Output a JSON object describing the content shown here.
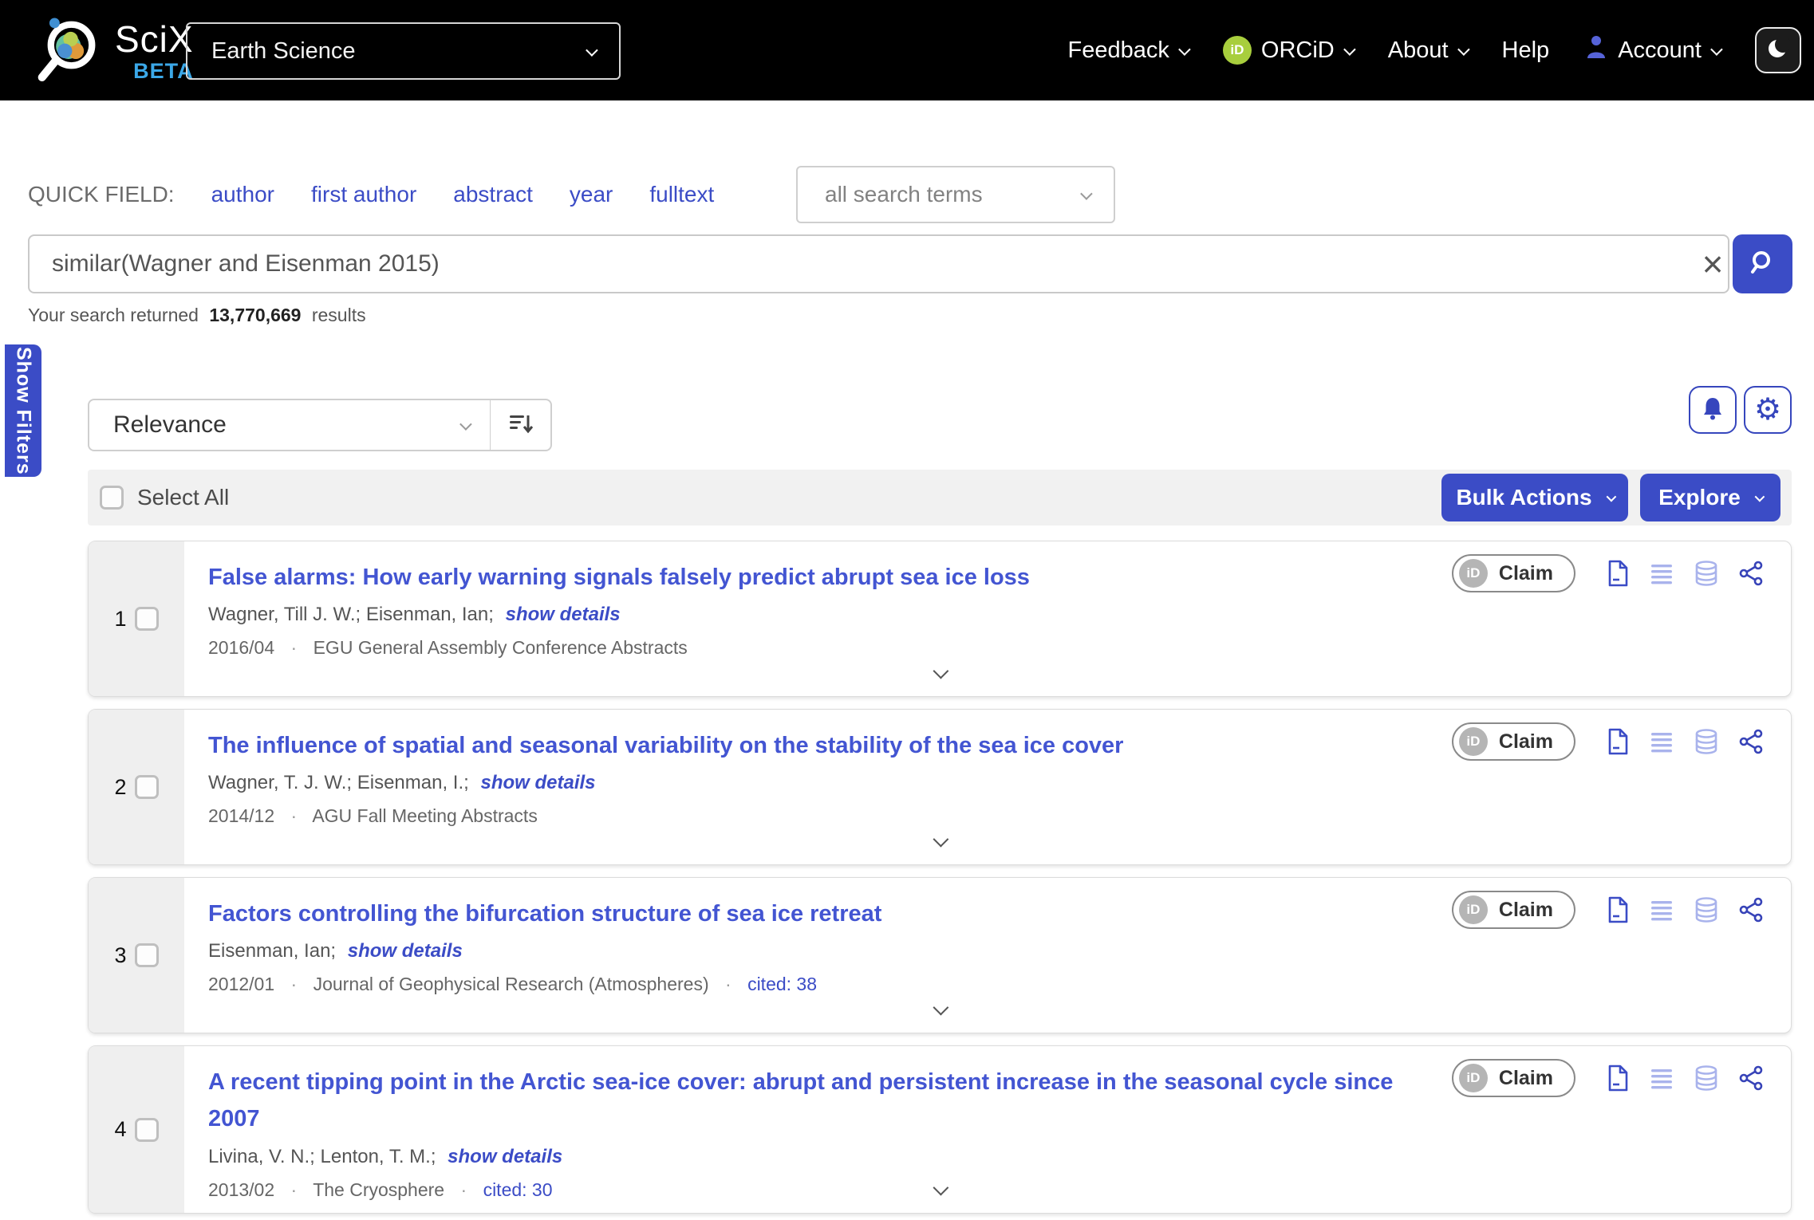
{
  "colors": {
    "accent": "#3b4cc6",
    "link": "#4355d2",
    "orcid_green": "#a8ce3d",
    "beta_blue": "#3ba8e8",
    "navbar_bg": "#000000"
  },
  "navbar": {
    "brand": "SciX",
    "brand_beta": "BETA",
    "collection": "Earth Science",
    "feedback": "Feedback",
    "orcid_icon_text": "iD",
    "orcid": "ORCiD",
    "about": "About",
    "help": "Help",
    "account": "Account"
  },
  "quick_fields": {
    "label": "QUICK FIELD:",
    "author": "author",
    "first_author": "first author",
    "abstract": "abstract",
    "year": "year",
    "fulltext": "fulltext",
    "terms": "all search terms"
  },
  "search": {
    "query": "similar(Wagner and Eisenman 2015)",
    "clear": "×"
  },
  "results_info": {
    "prefix": "Your search returned",
    "count": "13,770,669",
    "suffix": "results"
  },
  "filters_tab": {
    "label": "Show Filters"
  },
  "toolbar": {
    "sort": "Relevance"
  },
  "list_header": {
    "select_all": "Select All",
    "bulk_actions": "Bulk Actions",
    "explore": "Explore"
  },
  "sep": "·",
  "claim": {
    "icon_text": "iD",
    "label": "Claim"
  },
  "results": [
    {
      "index": "1",
      "title": "False alarms: How early warning signals falsely predict abrupt sea ice loss",
      "authors": "Wagner, Till J. W.; Eisenman, Ian;",
      "show_details": "show details",
      "date": "2016/04",
      "venue": "EGU General Assembly Conference Abstracts"
    },
    {
      "index": "2",
      "title": "The influence of spatial and seasonal variability on the stability of the sea ice cover",
      "authors": "Wagner, T. J. W.; Eisenman, I.;",
      "show_details": "show details",
      "date": "2014/12",
      "venue": "AGU Fall Meeting Abstracts"
    },
    {
      "index": "3",
      "title": "Factors controlling the bifurcation structure of sea ice retreat",
      "authors": "Eisenman, Ian;",
      "show_details": "show details",
      "date": "2012/01",
      "venue": "Journal of Geophysical Research (Atmospheres)",
      "cited": "cited: 38"
    },
    {
      "index": "4",
      "title": "A recent tipping point in the Arctic sea-ice cover: abrupt and persistent increase in the seasonal cycle since 2007",
      "authors": "Livina, V. N.; Lenton, T. M.;",
      "show_details": "show details",
      "date": "2013/02",
      "venue": "The Cryosphere",
      "cited": "cited: 30"
    }
  ]
}
